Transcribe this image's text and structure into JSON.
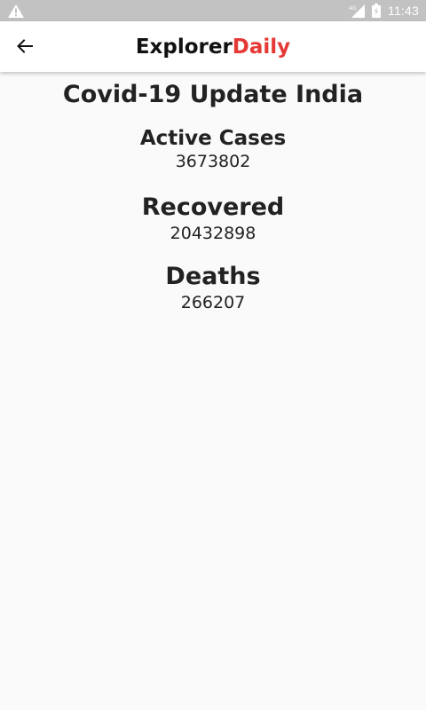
{
  "status_bar": {
    "time": "11:43",
    "network_label": "4G",
    "icons": [
      "warning-icon",
      "signal-icon",
      "battery-icon"
    ]
  },
  "app_bar": {
    "title_part_a": "Explorer",
    "title_part_b": "Daily",
    "back_icon": "arrow-left-icon",
    "title_accent_color": "#e53935"
  },
  "main": {
    "title": "Covid-19 Update India",
    "stats": [
      {
        "label": "Active Cases",
        "value": "3673802"
      },
      {
        "label": "Recovered",
        "value": "20432898"
      },
      {
        "label": "Deaths",
        "value": "266207"
      }
    ]
  }
}
